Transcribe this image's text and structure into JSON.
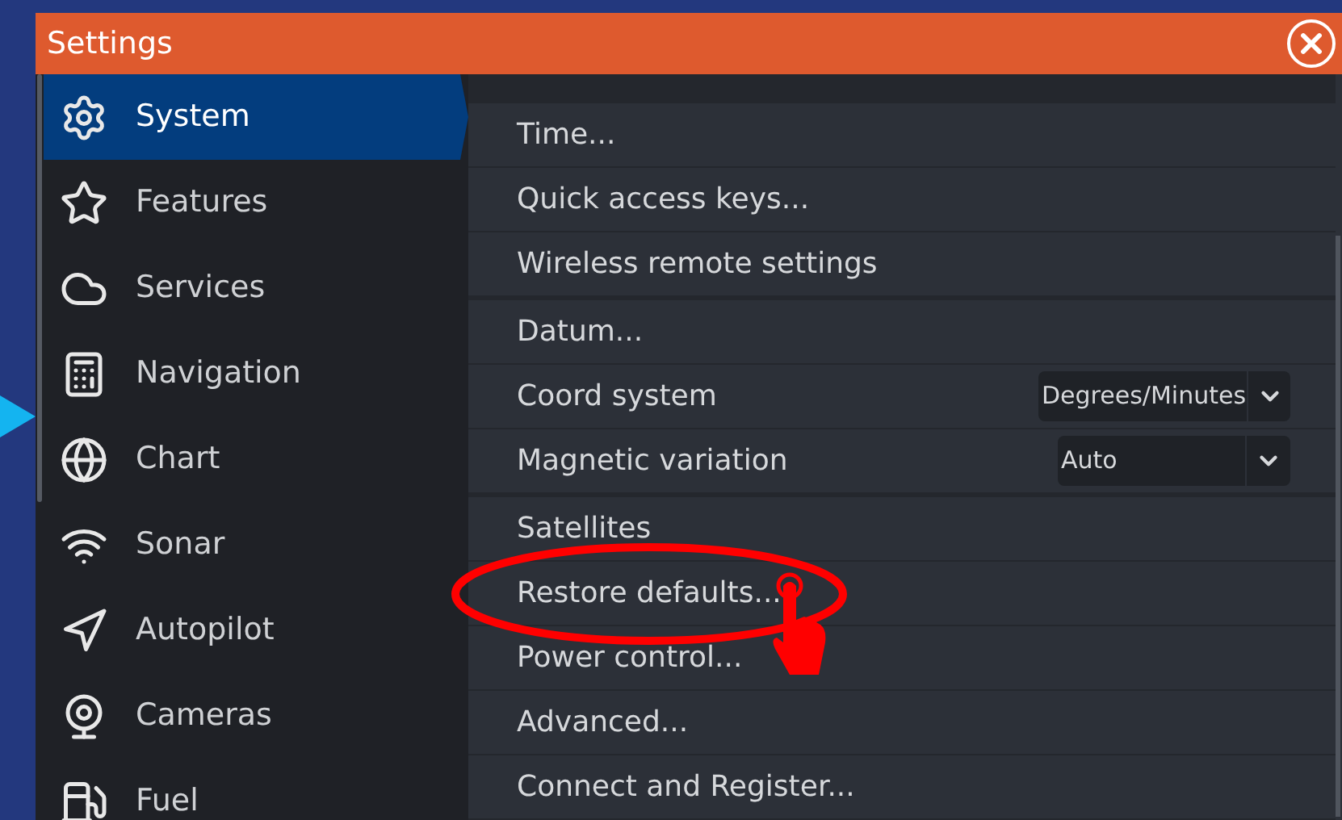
{
  "window": {
    "title": "Settings"
  },
  "sidebar": {
    "items": [
      {
        "label": "System",
        "selected": true
      },
      {
        "label": "Features",
        "selected": false
      },
      {
        "label": "Services",
        "selected": false
      },
      {
        "label": "Navigation",
        "selected": false
      },
      {
        "label": "Chart",
        "selected": false
      },
      {
        "label": "Sonar",
        "selected": false
      },
      {
        "label": "Autopilot",
        "selected": false
      },
      {
        "label": "Cameras",
        "selected": false
      },
      {
        "label": "Fuel",
        "selected": false
      }
    ]
  },
  "settings": {
    "groups": [
      {
        "rows": [
          {
            "kind": "action",
            "label": "Time...",
            "highlighted": false
          },
          {
            "kind": "action",
            "label": "Quick access keys...",
            "highlighted": false
          },
          {
            "kind": "action",
            "label": "Wireless remote settings",
            "highlighted": false
          }
        ]
      },
      {
        "rows": [
          {
            "kind": "action",
            "label": "Datum...",
            "highlighted": false
          },
          {
            "kind": "dropdown",
            "label": "Coord system",
            "value": "Degrees/Minutes"
          },
          {
            "kind": "dropdown",
            "label": "Magnetic variation",
            "value": "Auto"
          }
        ]
      },
      {
        "rows": [
          {
            "kind": "action",
            "label": "Satellites",
            "highlighted": false
          },
          {
            "kind": "action",
            "label": "Restore defaults...",
            "highlighted": true
          },
          {
            "kind": "action",
            "label": "Power control...",
            "highlighted": false
          },
          {
            "kind": "action",
            "label": "Advanced...",
            "highlighted": false
          },
          {
            "kind": "action",
            "label": "Connect and Register...",
            "highlighted": false
          }
        ]
      }
    ]
  }
}
